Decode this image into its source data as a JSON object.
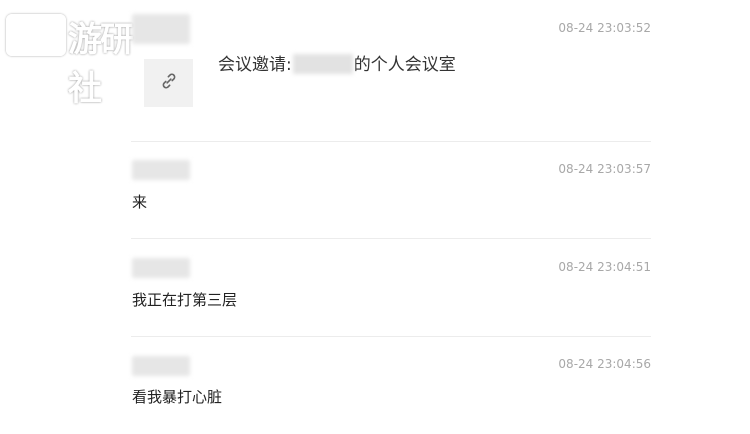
{
  "watermark": {
    "text": "游研社",
    "icon": "gamepad-icon"
  },
  "messages": [
    {
      "timestamp": "08-24 23:03:52",
      "type": "meeting-invite",
      "text_prefix": "会议邀请:",
      "text_suffix": "的个人会议室",
      "icon": "link-icon"
    },
    {
      "timestamp": "08-24 23:03:57",
      "text": "来"
    },
    {
      "timestamp": "08-24 23:04:51",
      "text": "我正在打第三层"
    },
    {
      "timestamp": "08-24 23:04:56",
      "text": "看我暴打心脏"
    }
  ],
  "colors": {
    "timestamp": "#a8a8a8",
    "divider": "#ececec",
    "link_card_bg": "#f1f1f1"
  }
}
